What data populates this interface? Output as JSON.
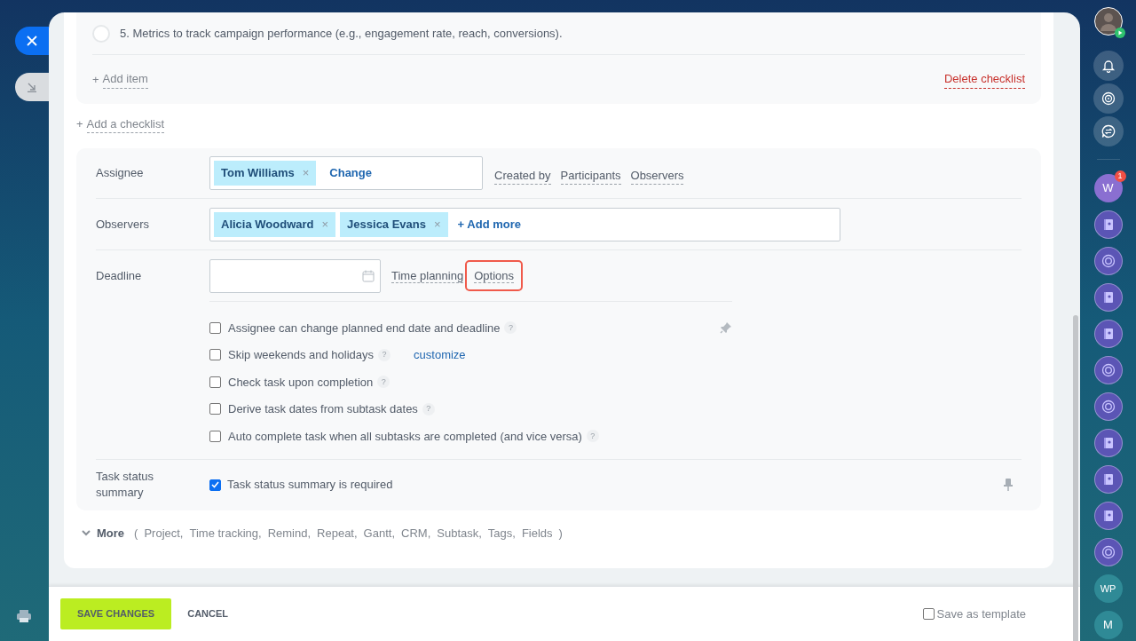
{
  "checklist": {
    "items": [
      {
        "text": "5. Metrics to track campaign performance (e.g., engagement rate, reach, conversions).",
        "checked": false
      }
    ],
    "add_item": {
      "icon": "+",
      "label": "Add item"
    },
    "delete": "Delete checklist"
  },
  "add_checklist": {
    "icon": "+",
    "label": "Add a checklist"
  },
  "assignee": {
    "label": "Assignee",
    "tags": [
      {
        "name": "Tom Williams",
        "remove": "×"
      }
    ],
    "action": "Change",
    "links": [
      "Created by",
      "Participants",
      "Observers"
    ]
  },
  "observers": {
    "label": "Observers",
    "tags": [
      {
        "name": "Alicia Woodward",
        "remove": "×"
      },
      {
        "name": "Jessica Evans",
        "remove": "×"
      }
    ],
    "action_icon": "+",
    "action": "Add more"
  },
  "deadline": {
    "label": "Deadline",
    "links": [
      {
        "text": "Time planning",
        "highlighted": false
      },
      {
        "text": "Options",
        "highlighted": true
      }
    ]
  },
  "options": [
    {
      "text": "Assignee can change planned end date and deadline",
      "checked": false,
      "help": "?",
      "pinned": true
    },
    {
      "text": "Skip weekends and holidays",
      "checked": false,
      "help": "?",
      "link": "customize"
    },
    {
      "text": "Check task upon completion",
      "checked": false,
      "help": "?"
    },
    {
      "text": "Derive task dates from subtask dates",
      "checked": false,
      "help": "?"
    },
    {
      "text": "Auto complete task when all subtasks are completed (and vice versa)",
      "checked": false,
      "help": "?"
    }
  ],
  "summary": {
    "label": "Task status summary",
    "text": "Task status summary is required",
    "checked": true
  },
  "more": {
    "label": "More",
    "open": "(",
    "items": [
      "Project,",
      "Time tracking,",
      "Remind,",
      "Repeat,",
      "Gantt,",
      "CRM,",
      "Subtask,",
      "Tags,",
      "Fields"
    ],
    "close": ")"
  },
  "footer": {
    "save": "SAVE CHANGES",
    "cancel": "CANCEL",
    "template": {
      "label": "Save as template",
      "checked": false
    }
  },
  "sidebar": [
    {
      "kind": "avatar"
    },
    {
      "kind": "bell"
    },
    {
      "kind": "swirl"
    },
    {
      "kind": "chat"
    },
    {
      "kind": "divider"
    },
    {
      "kind": "letter",
      "text": "W",
      "badge": "1",
      "color": "#8a6fd1"
    },
    {
      "kind": "book"
    },
    {
      "kind": "swirl-chat"
    },
    {
      "kind": "book"
    },
    {
      "kind": "book"
    },
    {
      "kind": "swirl-chat"
    },
    {
      "kind": "swirl-chat"
    },
    {
      "kind": "book"
    },
    {
      "kind": "book"
    },
    {
      "kind": "book"
    },
    {
      "kind": "swirl-chat"
    },
    {
      "kind": "letter",
      "text": "WP",
      "color": "#2f8a96"
    },
    {
      "kind": "letter",
      "text": "M",
      "color": "#2f8a96"
    }
  ]
}
